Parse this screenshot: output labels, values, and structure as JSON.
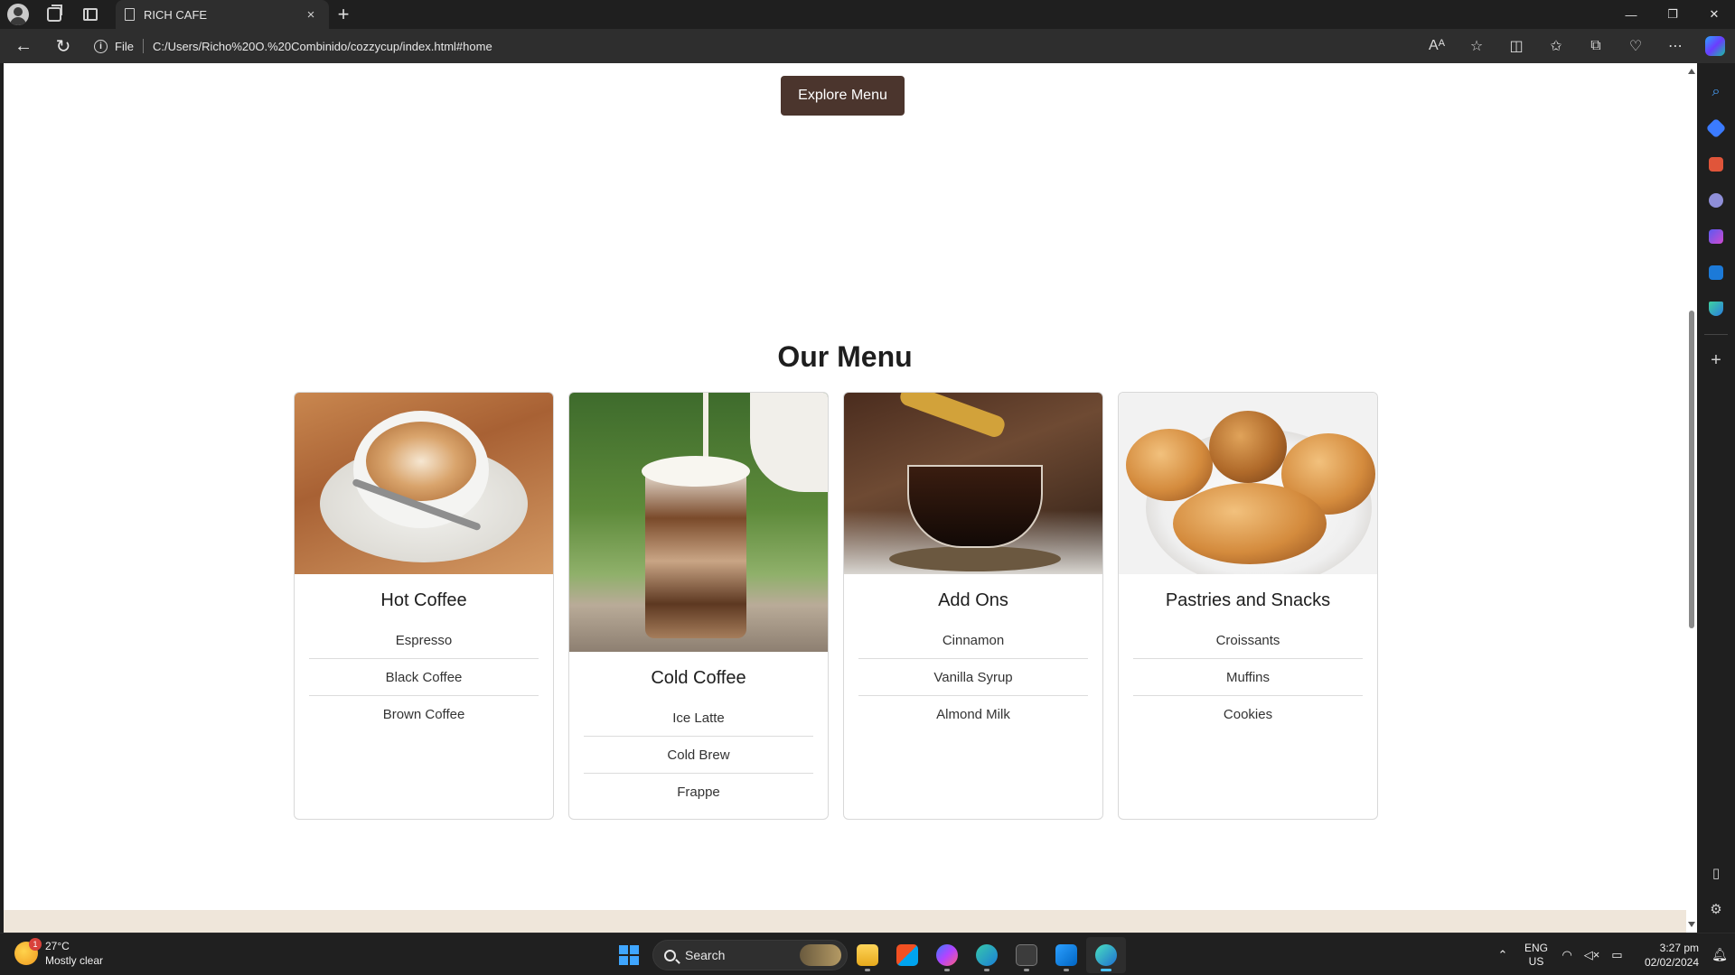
{
  "browser": {
    "tab_title": "RICH CAFE",
    "close_glyph": "×",
    "new_tab_glyph": "+",
    "file_label": "File",
    "url": "C:/Users/Richo%20O.%20Combinido/cozzycup/index.html#home",
    "window_controls": {
      "minimize": "—",
      "restore": "❐",
      "close": "✕"
    },
    "toolbar_icons": [
      "read-aloud-icon",
      "favorite-star-icon",
      "split-screen-icon",
      "favorites-icon",
      "collections-icon",
      "browser-essentials-icon",
      "more-icon",
      "copilot-icon"
    ],
    "sidebar_icons": [
      "search-icon",
      "shopping-tag-icon",
      "tools-icon",
      "games-icon",
      "office-icon",
      "outlook-icon",
      "drop-icon"
    ]
  },
  "page": {
    "explore_button": "Explore Menu",
    "menu_title": "Our Menu",
    "cards": [
      {
        "name": "Hot Coffee",
        "image": "latte-art-cup-image",
        "items": [
          "Espresso",
          "Black Coffee",
          "Brown Coffee"
        ]
      },
      {
        "name": "Cold Coffee",
        "image": "iced-latte-glass-image",
        "items": [
          "Ice Latte",
          "Cold Brew",
          "Frappe"
        ]
      },
      {
        "name": "Add Ons",
        "image": "syrup-pour-coffee-image",
        "items": [
          "Cinnamon",
          "Vanilla Syrup",
          "Almond Milk"
        ]
      },
      {
        "name": "Pastries and Snacks",
        "image": "croissants-plate-image",
        "items": [
          "Croissants",
          "Muffins",
          "Cookies"
        ]
      }
    ],
    "colors": {
      "button_bg": "#4b352d",
      "footer_strip": "#efe6da"
    }
  },
  "taskbar": {
    "weather_badge": "1",
    "temperature": "27°C",
    "condition": "Mostly clear",
    "search_placeholder": "Search",
    "apps": [
      "file-explorer-icon",
      "store-icon",
      "messenger-icon",
      "edge-icon",
      "terminal-icon",
      "vscode-icon",
      "edge-dev-icon"
    ],
    "lang_line1": "ENG",
    "lang_line2": "US",
    "time": "3:27 pm",
    "date": "02/02/2024"
  }
}
